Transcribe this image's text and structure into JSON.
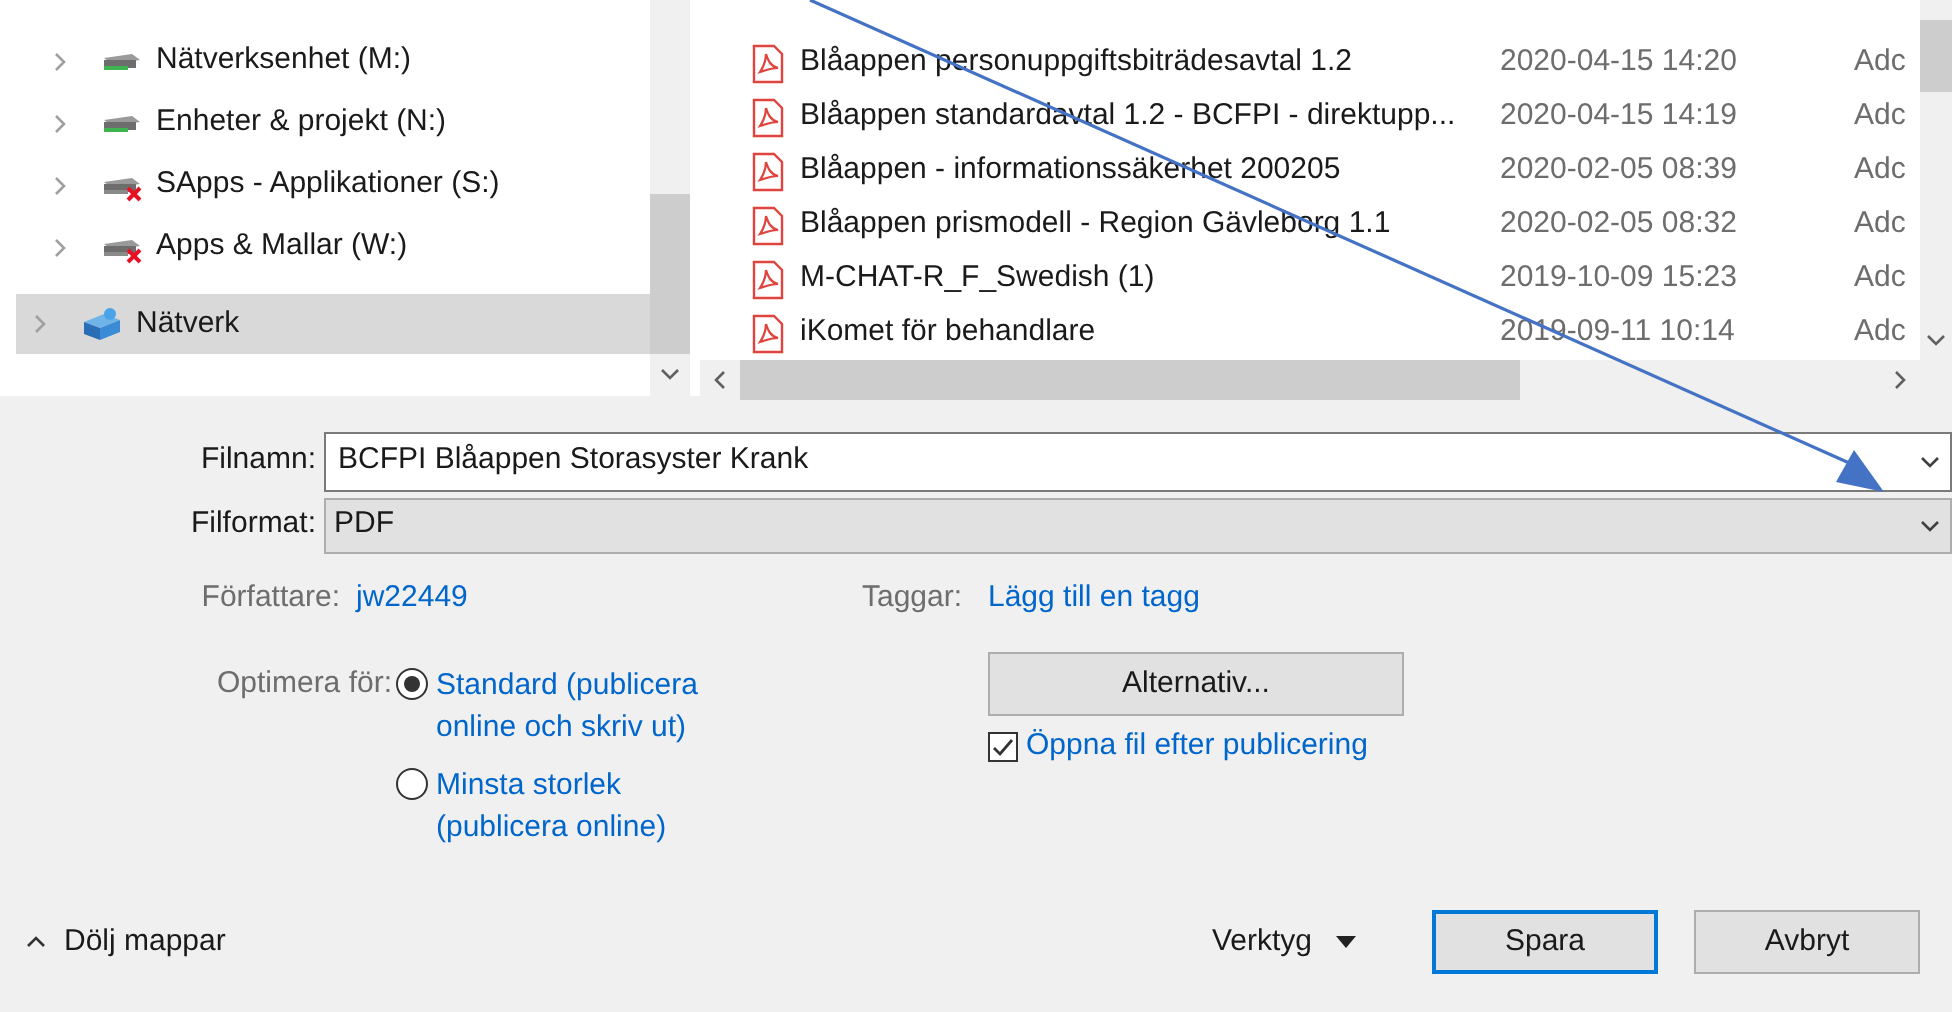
{
  "nav_tree": [
    {
      "label": "Nätverksenhet (M:)",
      "kind": "drive",
      "connected": true,
      "selected": false
    },
    {
      "label": "Enheter & projekt (N:)",
      "kind": "drive",
      "connected": true,
      "selected": false
    },
    {
      "label": "SApps - Applikationer (S:)",
      "kind": "drive",
      "connected": false,
      "selected": false
    },
    {
      "label": "Apps & Mallar (W:)",
      "kind": "drive",
      "connected": false,
      "selected": false
    },
    {
      "label": "Nätverk",
      "kind": "network",
      "selected": true
    }
  ],
  "files": [
    {
      "name": "Blåappen personuppgiftsbiträdesavtal 1.2",
      "date": "2020-04-15 14:20",
      "type": "Adc"
    },
    {
      "name": "Blåappen standardavtal 1.2 - BCFPI - direktupp...",
      "date": "2020-04-15 14:19",
      "type": "Adc"
    },
    {
      "name": "Blåappen - informationssäkerhet 200205",
      "date": "2020-02-05 08:39",
      "type": "Adc"
    },
    {
      "name": "Blåappen prismodell - Region Gävleborg 1.1",
      "date": "2020-02-05 08:32",
      "type": "Adc"
    },
    {
      "name": "M-CHAT-R_F_Swedish (1)",
      "date": "2019-10-09 15:23",
      "type": "Adc"
    },
    {
      "name": "iKomet för behandlare",
      "date": "2019-09-11 10:14",
      "type": "Adc"
    }
  ],
  "filename": {
    "label": "Filnamn:",
    "value": "BCFPI Blåappen Storasyster Krank"
  },
  "format": {
    "label": "Filformat:",
    "value": "PDF"
  },
  "author": {
    "label": "Författare:",
    "value": "jw22449"
  },
  "tags": {
    "label": "Taggar:",
    "value": "Lägg till en tagg"
  },
  "optimize": {
    "label": "Optimera för:",
    "options": [
      {
        "label": "Standard (publicera online och skriv ut)",
        "selected": true
      },
      {
        "label": "Minsta storlek (publicera online)",
        "selected": false
      }
    ]
  },
  "options_button": "Alternativ...",
  "open_after": {
    "label": "Öppna fil efter publicering",
    "checked": true
  },
  "hide_folders": "Dölj mappar",
  "tools": "Verktyg",
  "buttons": [
    {
      "label": "Spara",
      "kind": "primary"
    },
    {
      "label": "Avbryt",
      "kind": "default"
    }
  ]
}
